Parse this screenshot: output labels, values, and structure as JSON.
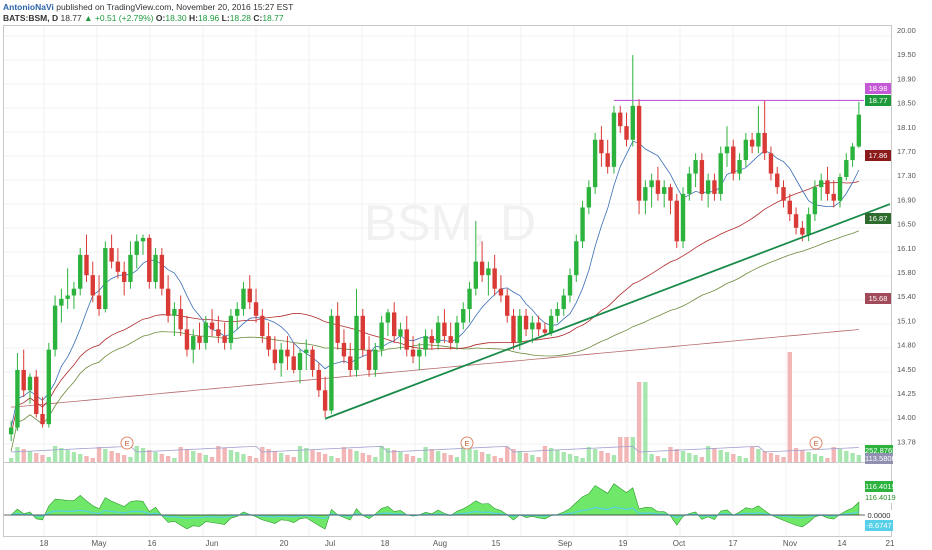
{
  "header": {
    "author": "AntonioNaVi",
    "published": "published on TradingView.com, November 20, 2016 15:27 EST",
    "symbol": "BATS:BSM, D",
    "last": "18.77",
    "change": "+0.51 (+2.79%)",
    "open_label": "O:",
    "open": "18.30",
    "high_label": "H:",
    "high": "18.96",
    "low_label": "L:",
    "low": "18.28",
    "close_label": "C:",
    "close": "18.77"
  },
  "watermark": "BSM, D",
  "colors": {
    "up": "#2bb33e",
    "down": "#d93a35",
    "resistance": "#c45ad6",
    "trendline": "#1a8b4a",
    "ma_short": "#3a6fb5",
    "ma_mid": "#b02a2a",
    "ma_long": "#6d8a3a",
    "ma_200": "#b66a6a",
    "osc_fill": "#6fe86a",
    "osc_neg": "#55d0e8"
  },
  "price_axis": {
    "ticks": [
      "20.00",
      "19.50",
      "18.90",
      "18.50",
      "18.10",
      "17.70",
      "17.30",
      "16.90",
      "16.50",
      "16.10",
      "15.80",
      "15.40",
      "15.10",
      "14.80",
      "14.50",
      "14.25",
      "14.00",
      "13.78"
    ]
  },
  "price_tags": [
    {
      "value": "18.98",
      "color": "#c45ad6"
    },
    {
      "value": "18.77",
      "color": "#1e9a3c"
    },
    {
      "value": "17.86",
      "color": "#8b1a1a"
    },
    {
      "value": "16.87",
      "color": "#2e6b2e"
    },
    {
      "value": "15.68",
      "color": "#a04a5a"
    },
    {
      "value": "252.876K",
      "color": "#2bb33e"
    },
    {
      "value": "113.580K",
      "color": "#9090b0"
    }
  ],
  "osc_axis": {
    "tags": [
      {
        "value": "116.4019",
        "color": "#2bb33e"
      },
      {
        "value": "116.4019",
        "color": "#ffffff"
      },
      {
        "value": "0.0000",
        "color": "#333333"
      },
      {
        "value": "-8.6747",
        "color": "#55d0e8"
      }
    ]
  },
  "date_labels": [
    "18",
    "May",
    "16",
    "Jun",
    "20",
    "Jul",
    "18",
    "Aug",
    "15",
    "Sep",
    "19",
    "Oct",
    "17",
    "Nov",
    "14",
    "21"
  ],
  "earnings_marker": "E",
  "chart_data": {
    "type": "candlestick",
    "symbol": "BSM",
    "interval": "D",
    "ylim": [
      13.7,
      20.05
    ],
    "resistance_level": 18.98,
    "candles": [
      {
        "o": 14.05,
        "h": 14.25,
        "l": 13.95,
        "c": 14.15
      },
      {
        "o": 14.15,
        "h": 15.25,
        "l": 14.1,
        "c": 15.0
      },
      {
        "o": 15.0,
        "h": 15.3,
        "l": 14.6,
        "c": 14.7
      },
      {
        "o": 14.7,
        "h": 14.95,
        "l": 14.5,
        "c": 14.9
      },
      {
        "o": 14.9,
        "h": 15.0,
        "l": 14.3,
        "c": 14.35
      },
      {
        "o": 14.35,
        "h": 14.6,
        "l": 14.15,
        "c": 14.2
      },
      {
        "o": 14.2,
        "h": 15.4,
        "l": 14.15,
        "c": 15.3
      },
      {
        "o": 15.3,
        "h": 16.1,
        "l": 15.2,
        "c": 15.95
      },
      {
        "o": 15.95,
        "h": 16.2,
        "l": 15.7,
        "c": 16.05
      },
      {
        "o": 16.05,
        "h": 16.5,
        "l": 15.9,
        "c": 16.1
      },
      {
        "o": 16.1,
        "h": 16.3,
        "l": 15.9,
        "c": 16.2
      },
      {
        "o": 16.2,
        "h": 16.8,
        "l": 16.1,
        "c": 16.7
      },
      {
        "o": 16.7,
        "h": 17.0,
        "l": 16.3,
        "c": 16.4
      },
      {
        "o": 16.4,
        "h": 16.6,
        "l": 16.0,
        "c": 16.1
      },
      {
        "o": 16.1,
        "h": 16.4,
        "l": 15.8,
        "c": 15.9
      },
      {
        "o": 15.9,
        "h": 16.9,
        "l": 15.85,
        "c": 16.8
      },
      {
        "o": 16.8,
        "h": 17.0,
        "l": 16.5,
        "c": 16.6
      },
      {
        "o": 16.6,
        "h": 16.8,
        "l": 16.35,
        "c": 16.45
      },
      {
        "o": 16.45,
        "h": 16.6,
        "l": 16.1,
        "c": 16.3
      },
      {
        "o": 16.3,
        "h": 16.9,
        "l": 16.2,
        "c": 16.7
      },
      {
        "o": 16.7,
        "h": 17.0,
        "l": 16.5,
        "c": 16.9
      },
      {
        "o": 16.9,
        "h": 17.0,
        "l": 16.7,
        "c": 16.95
      },
      {
        "o": 16.95,
        "h": 17.0,
        "l": 16.2,
        "c": 16.3
      },
      {
        "o": 16.3,
        "h": 16.8,
        "l": 16.2,
        "c": 16.7
      },
      {
        "o": 16.7,
        "h": 16.8,
        "l": 16.1,
        "c": 16.2
      },
      {
        "o": 16.2,
        "h": 16.4,
        "l": 15.7,
        "c": 15.8
      },
      {
        "o": 15.8,
        "h": 16.0,
        "l": 15.5,
        "c": 15.9
      },
      {
        "o": 15.9,
        "h": 16.1,
        "l": 15.5,
        "c": 15.6
      },
      {
        "o": 15.6,
        "h": 15.8,
        "l": 15.2,
        "c": 15.3
      },
      {
        "o": 15.3,
        "h": 15.6,
        "l": 15.1,
        "c": 15.5
      },
      {
        "o": 15.5,
        "h": 15.7,
        "l": 15.3,
        "c": 15.4
      },
      {
        "o": 15.4,
        "h": 15.8,
        "l": 15.3,
        "c": 15.7
      },
      {
        "o": 15.7,
        "h": 15.9,
        "l": 15.5,
        "c": 15.6
      },
      {
        "o": 15.6,
        "h": 15.8,
        "l": 15.4,
        "c": 15.5
      },
      {
        "o": 15.5,
        "h": 15.7,
        "l": 15.3,
        "c": 15.4
      },
      {
        "o": 15.4,
        "h": 15.9,
        "l": 15.3,
        "c": 15.8
      },
      {
        "o": 15.8,
        "h": 16.0,
        "l": 15.6,
        "c": 15.9
      },
      {
        "o": 15.9,
        "h": 16.3,
        "l": 15.8,
        "c": 16.2
      },
      {
        "o": 16.2,
        "h": 16.4,
        "l": 15.9,
        "c": 16.0
      },
      {
        "o": 16.0,
        "h": 16.2,
        "l": 15.7,
        "c": 15.8
      },
      {
        "o": 15.8,
        "h": 15.9,
        "l": 15.4,
        "c": 15.5
      },
      {
        "o": 15.5,
        "h": 15.7,
        "l": 15.2,
        "c": 15.3
      },
      {
        "o": 15.3,
        "h": 15.5,
        "l": 15.0,
        "c": 15.1
      },
      {
        "o": 15.1,
        "h": 15.4,
        "l": 14.9,
        "c": 15.3
      },
      {
        "o": 15.3,
        "h": 15.5,
        "l": 15.0,
        "c": 15.2
      },
      {
        "o": 15.2,
        "h": 15.4,
        "l": 14.95,
        "c": 15.0
      },
      {
        "o": 15.0,
        "h": 15.3,
        "l": 14.8,
        "c": 15.25
      },
      {
        "o": 15.25,
        "h": 15.45,
        "l": 15.0,
        "c": 15.3
      },
      {
        "o": 15.3,
        "h": 15.35,
        "l": 14.9,
        "c": 15.0
      },
      {
        "o": 15.0,
        "h": 15.1,
        "l": 14.6,
        "c": 14.7
      },
      {
        "o": 14.7,
        "h": 14.9,
        "l": 14.3,
        "c": 14.4
      },
      {
        "o": 14.4,
        "h": 15.9,
        "l": 14.35,
        "c": 15.8
      },
      {
        "o": 15.8,
        "h": 16.0,
        "l": 15.3,
        "c": 15.4
      },
      {
        "o": 15.4,
        "h": 15.6,
        "l": 15.1,
        "c": 15.2
      },
      {
        "o": 15.2,
        "h": 15.4,
        "l": 14.9,
        "c": 15.0
      },
      {
        "o": 15.0,
        "h": 16.2,
        "l": 14.9,
        "c": 15.8
      },
      {
        "o": 15.8,
        "h": 15.9,
        "l": 15.2,
        "c": 15.3
      },
      {
        "o": 15.3,
        "h": 15.5,
        "l": 14.9,
        "c": 15.0
      },
      {
        "o": 15.0,
        "h": 15.4,
        "l": 14.9,
        "c": 15.3
      },
      {
        "o": 15.3,
        "h": 15.8,
        "l": 15.2,
        "c": 15.7
      },
      {
        "o": 15.7,
        "h": 15.9,
        "l": 15.5,
        "c": 15.85
      },
      {
        "o": 15.85,
        "h": 16.0,
        "l": 15.4,
        "c": 15.5
      },
      {
        "o": 15.5,
        "h": 15.7,
        "l": 15.3,
        "c": 15.6
      },
      {
        "o": 15.6,
        "h": 15.8,
        "l": 15.2,
        "c": 15.3
      },
      {
        "o": 15.3,
        "h": 15.5,
        "l": 15.1,
        "c": 15.2
      },
      {
        "o": 15.2,
        "h": 15.4,
        "l": 15.0,
        "c": 15.3
      },
      {
        "o": 15.3,
        "h": 15.6,
        "l": 15.2,
        "c": 15.5
      },
      {
        "o": 15.5,
        "h": 15.6,
        "l": 15.3,
        "c": 15.4
      },
      {
        "o": 15.4,
        "h": 15.8,
        "l": 15.3,
        "c": 15.7
      },
      {
        "o": 15.7,
        "h": 15.9,
        "l": 15.4,
        "c": 15.5
      },
      {
        "o": 15.5,
        "h": 15.7,
        "l": 15.3,
        "c": 15.4
      },
      {
        "o": 15.4,
        "h": 15.8,
        "l": 15.3,
        "c": 15.7
      },
      {
        "o": 15.7,
        "h": 16.0,
        "l": 15.6,
        "c": 15.9
      },
      {
        "o": 15.9,
        "h": 16.3,
        "l": 15.7,
        "c": 16.2
      },
      {
        "o": 16.2,
        "h": 17.2,
        "l": 16.1,
        "c": 16.6
      },
      {
        "o": 16.6,
        "h": 16.9,
        "l": 16.3,
        "c": 16.4
      },
      {
        "o": 16.4,
        "h": 16.6,
        "l": 16.1,
        "c": 16.5
      },
      {
        "o": 16.5,
        "h": 16.7,
        "l": 16.1,
        "c": 16.2
      },
      {
        "o": 16.2,
        "h": 16.4,
        "l": 16.0,
        "c": 16.1
      },
      {
        "o": 16.1,
        "h": 16.2,
        "l": 15.7,
        "c": 15.8
      },
      {
        "o": 15.8,
        "h": 15.9,
        "l": 15.3,
        "c": 15.4
      },
      {
        "o": 15.4,
        "h": 15.9,
        "l": 15.3,
        "c": 15.8
      },
      {
        "o": 15.8,
        "h": 15.9,
        "l": 15.5,
        "c": 15.6
      },
      {
        "o": 15.6,
        "h": 15.8,
        "l": 15.4,
        "c": 15.7
      },
      {
        "o": 15.7,
        "h": 15.8,
        "l": 15.5,
        "c": 15.6
      },
      {
        "o": 15.6,
        "h": 15.7,
        "l": 15.5,
        "c": 15.55
      },
      {
        "o": 15.55,
        "h": 15.9,
        "l": 15.5,
        "c": 15.8
      },
      {
        "o": 15.8,
        "h": 16.0,
        "l": 15.7,
        "c": 15.9
      },
      {
        "o": 15.9,
        "h": 16.2,
        "l": 15.8,
        "c": 16.1
      },
      {
        "o": 16.1,
        "h": 16.5,
        "l": 16.0,
        "c": 16.4
      },
      {
        "o": 16.4,
        "h": 17.0,
        "l": 16.3,
        "c": 16.9
      },
      {
        "o": 16.9,
        "h": 17.5,
        "l": 16.8,
        "c": 17.4
      },
      {
        "o": 17.4,
        "h": 17.8,
        "l": 17.3,
        "c": 17.7
      },
      {
        "o": 17.7,
        "h": 18.5,
        "l": 17.6,
        "c": 18.4
      },
      {
        "o": 18.4,
        "h": 18.6,
        "l": 18.0,
        "c": 18.2
      },
      {
        "o": 18.2,
        "h": 18.4,
        "l": 17.9,
        "c": 18.0
      },
      {
        "o": 18.0,
        "h": 18.9,
        "l": 17.9,
        "c": 18.8
      },
      {
        "o": 18.8,
        "h": 18.9,
        "l": 18.5,
        "c": 18.6
      },
      {
        "o": 18.6,
        "h": 18.8,
        "l": 18.3,
        "c": 18.4
      },
      {
        "o": 18.4,
        "h": 19.65,
        "l": 18.3,
        "c": 18.9
      },
      {
        "o": 18.9,
        "h": 19.0,
        "l": 17.3,
        "c": 17.5
      },
      {
        "o": 17.5,
        "h": 17.8,
        "l": 17.3,
        "c": 17.7
      },
      {
        "o": 17.7,
        "h": 17.9,
        "l": 17.4,
        "c": 17.8
      },
      {
        "o": 17.8,
        "h": 18.0,
        "l": 17.5,
        "c": 17.6
      },
      {
        "o": 17.6,
        "h": 17.8,
        "l": 17.4,
        "c": 17.7
      },
      {
        "o": 17.7,
        "h": 17.75,
        "l": 17.3,
        "c": 17.5
      },
      {
        "o": 17.5,
        "h": 17.6,
        "l": 16.8,
        "c": 16.9
      },
      {
        "o": 16.9,
        "h": 17.7,
        "l": 16.8,
        "c": 17.6
      },
      {
        "o": 17.6,
        "h": 18.0,
        "l": 17.5,
        "c": 17.9
      },
      {
        "o": 17.9,
        "h": 18.2,
        "l": 17.7,
        "c": 18.1
      },
      {
        "o": 18.1,
        "h": 18.2,
        "l": 17.5,
        "c": 17.6
      },
      {
        "o": 17.6,
        "h": 17.9,
        "l": 17.4,
        "c": 17.8
      },
      {
        "o": 17.8,
        "h": 17.9,
        "l": 17.5,
        "c": 17.6
      },
      {
        "o": 17.6,
        "h": 18.3,
        "l": 17.5,
        "c": 18.2
      },
      {
        "o": 18.2,
        "h": 18.6,
        "l": 18.0,
        "c": 18.3
      },
      {
        "o": 18.3,
        "h": 18.4,
        "l": 17.8,
        "c": 17.9
      },
      {
        "o": 17.9,
        "h": 18.2,
        "l": 17.8,
        "c": 18.1
      },
      {
        "o": 18.1,
        "h": 18.5,
        "l": 18.0,
        "c": 18.4
      },
      {
        "o": 18.4,
        "h": 18.5,
        "l": 18.2,
        "c": 18.3
      },
      {
        "o": 18.3,
        "h": 18.9,
        "l": 18.2,
        "c": 18.5
      },
      {
        "o": 18.5,
        "h": 18.98,
        "l": 18.1,
        "c": 18.2
      },
      {
        "o": 18.2,
        "h": 18.3,
        "l": 17.8,
        "c": 17.9
      },
      {
        "o": 17.9,
        "h": 18.0,
        "l": 17.6,
        "c": 17.7
      },
      {
        "o": 17.7,
        "h": 17.8,
        "l": 17.4,
        "c": 17.5
      },
      {
        "o": 17.5,
        "h": 17.6,
        "l": 17.2,
        "c": 17.3
      },
      {
        "o": 17.3,
        "h": 17.4,
        "l": 17.0,
        "c": 17.1
      },
      {
        "o": 17.1,
        "h": 17.2,
        "l": 16.9,
        "c": 17.0
      },
      {
        "o": 17.0,
        "h": 17.4,
        "l": 16.9,
        "c": 17.3
      },
      {
        "o": 17.3,
        "h": 17.8,
        "l": 17.2,
        "c": 17.7
      },
      {
        "o": 17.7,
        "h": 17.9,
        "l": 17.5,
        "c": 17.8
      },
      {
        "o": 17.8,
        "h": 18.0,
        "l": 17.5,
        "c": 17.6
      },
      {
        "o": 17.6,
        "h": 17.8,
        "l": 17.4,
        "c": 17.5
      },
      {
        "o": 17.5,
        "h": 17.9,
        "l": 17.4,
        "c": 17.85
      },
      {
        "o": 17.85,
        "h": 18.2,
        "l": 17.8,
        "c": 18.1
      },
      {
        "o": 18.1,
        "h": 18.35,
        "l": 18.0,
        "c": 18.3
      },
      {
        "o": 18.3,
        "h": 18.96,
        "l": 18.28,
        "c": 18.77
      }
    ],
    "volume_bars": 140,
    "oscillator_zero": 0.0,
    "oscillator_last": 116.4019,
    "oscillator_signal": -8.6747
  }
}
